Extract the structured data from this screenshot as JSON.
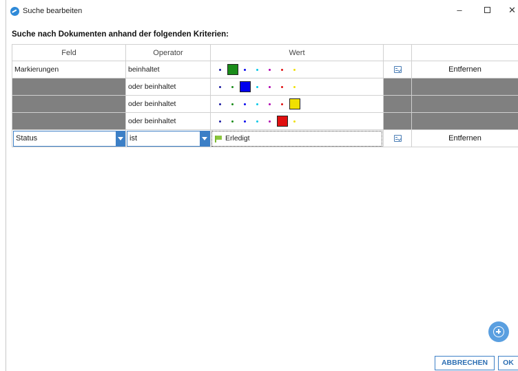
{
  "window": {
    "title": "Suche bearbeiten",
    "minimize_glyph": "–",
    "close_glyph": "✕"
  },
  "heading": "Suche nach Dokumenten anhand der folgenden Kriterien:",
  "grid": {
    "headers": {
      "feld": "Feld",
      "operator": "Operator",
      "wert": "Wert"
    },
    "rows": [
      {
        "feld": "Markierungen",
        "operator": "beinhaltet",
        "remove": "Entfernen"
      },
      {
        "feld": "",
        "operator": "oder beinhaltet"
      },
      {
        "feld": "",
        "operator": "oder beinhaltet"
      },
      {
        "feld": "",
        "operator": "oder beinhaltet"
      },
      {
        "feld": "Status",
        "operator": "ist",
        "wert": "Erledigt",
        "remove": "Entfernen"
      }
    ],
    "marker_colors": [
      "#1a1aa0",
      "#1a8c1a",
      "#0000ee",
      "#00c8e8",
      "#b000b0",
      "#e01010",
      "#f0e000"
    ],
    "marker_selected_index": [
      1,
      2,
      6,
      5
    ]
  },
  "buttons": {
    "cancel": "ABBRECHEN",
    "ok": "OK",
    "add_icon": "plus-circle-icon"
  },
  "colors": {
    "accent": "#3c7fc6",
    "disabled_cell": "#808080",
    "flag": "#8cc63f"
  }
}
